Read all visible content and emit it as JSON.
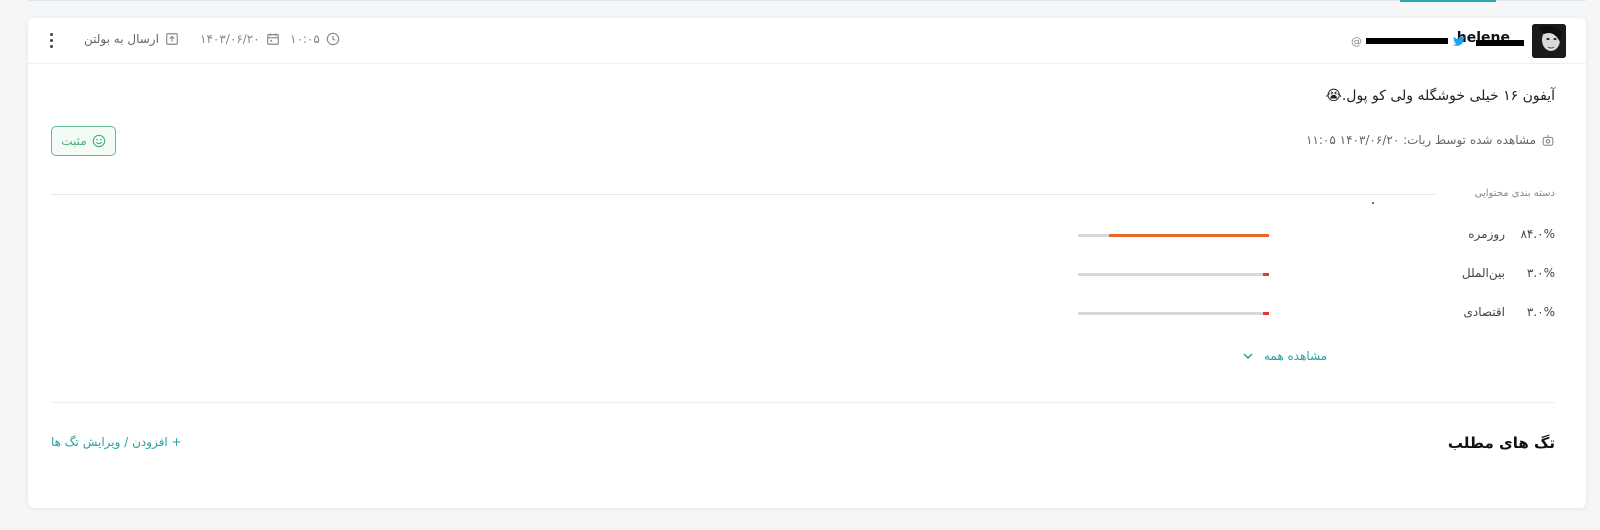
{
  "header": {
    "username": "helene",
    "handle": "@",
    "time": "۱۰:۰۵",
    "date": "۱۴۰۳/۰۶/۲۰",
    "bulletin_label": "ارسال به بولتن"
  },
  "post": {
    "text": "آیفون ۱۶ خیلی خوشگله ولی کو پول.",
    "emoji": "😭"
  },
  "sentiment": {
    "label": "مثبت"
  },
  "seen": {
    "label": "مشاهده شده توسط ربات: ۱۴۰۳/۰۶/۲۰ ۱۱:۰۵"
  },
  "categories": {
    "title": "دسته بندی محتوایی",
    "items": [
      {
        "label": "روزمره",
        "percent": "۸۴.۰%",
        "value": 84.0,
        "color": "#e8662a"
      },
      {
        "label": "بین‌الملل",
        "percent": "۳.۰%",
        "value": 3.0,
        "color": "#e53935"
      },
      {
        "label": "اقتصادی",
        "percent": "۳.۰%",
        "value": 3.0,
        "color": "#e53935"
      }
    ],
    "see_all": "مشاهده همه"
  },
  "tags": {
    "title": "تگ های مطلب",
    "edit_label": "+ افزودن / ویرایش تگ ها"
  },
  "colors": {
    "accent": "#2aa7a7",
    "positive": "#4cae7c",
    "bar_track": "#d4dae0"
  }
}
